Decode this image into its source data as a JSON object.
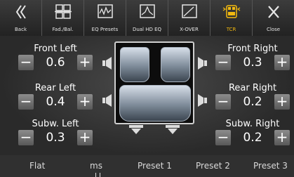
{
  "toolbar": {
    "items": [
      {
        "label": "Back",
        "icon": "back-chevrons-icon"
      },
      {
        "label": "Fad./Bal.",
        "icon": "fader-balance-icon"
      },
      {
        "label": "EQ Presets",
        "icon": "eq-presets-icon"
      },
      {
        "label": "Dual HD EQ",
        "icon": "dual-hd-eq-icon"
      },
      {
        "label": "X-OVER",
        "icon": "crossover-icon"
      },
      {
        "label": "TCR",
        "icon": "tcr-icon"
      },
      {
        "label": "Close",
        "icon": "close-icon"
      }
    ],
    "active": "TCR",
    "accent_color": "#f2b90f"
  },
  "controls": {
    "front_left": {
      "label": "Front Left",
      "value": "0.6",
      "minus": "−",
      "plus": "+"
    },
    "front_right": {
      "label": "Front Right",
      "value": "0.3",
      "minus": "−",
      "plus": "+"
    },
    "rear_left": {
      "label": "Rear Left",
      "value": "0.4",
      "minus": "−",
      "plus": "+"
    },
    "rear_right": {
      "label": "Rear Right",
      "value": "0.2",
      "minus": "−",
      "plus": "+"
    },
    "subw_left": {
      "label": "Subw. Left",
      "value": "0.3",
      "minus": "−",
      "plus": "+"
    },
    "subw_right": {
      "label": "Subw. Right",
      "value": "0.2",
      "minus": "−",
      "plus": "+"
    }
  },
  "bottom": {
    "flat": "Flat",
    "unit": "ms",
    "preset1": "Preset 1",
    "preset2": "Preset 2",
    "preset3": "Preset 3"
  }
}
